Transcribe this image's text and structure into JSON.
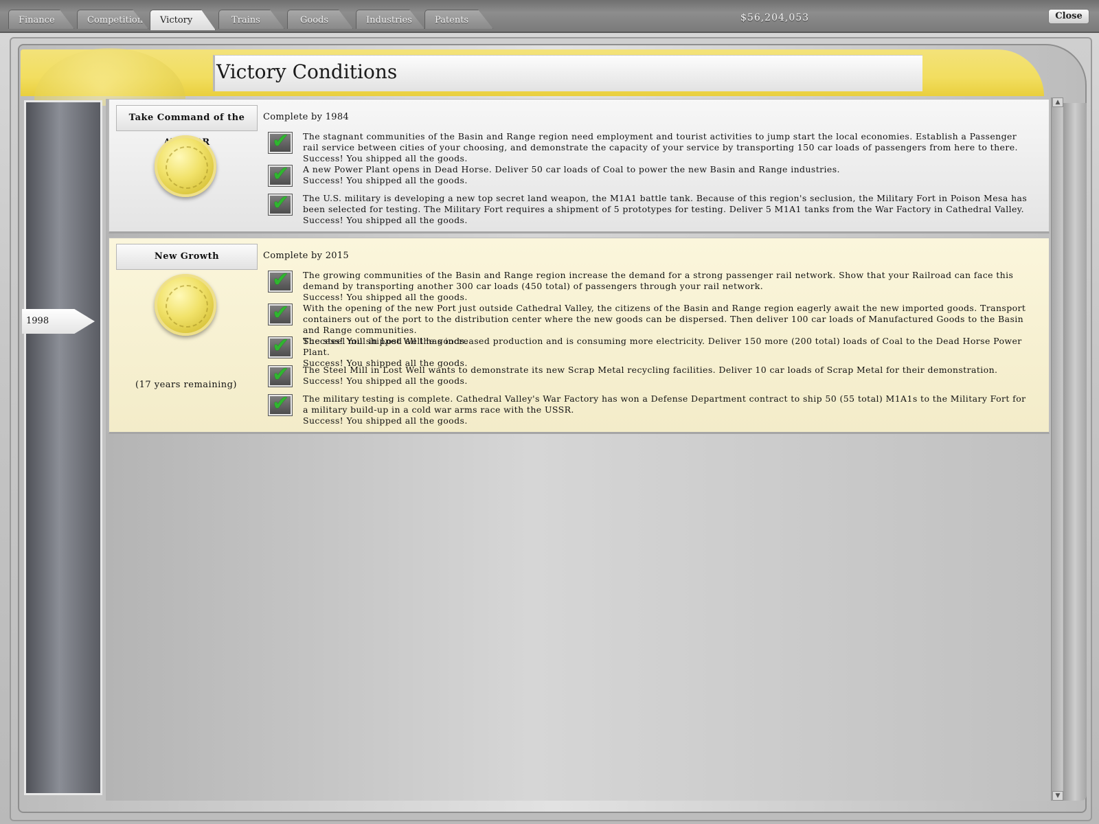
{
  "tabs": [
    "Finance",
    "Competition",
    "Victory",
    "Trains",
    "Goods",
    "Industries",
    "Patents"
  ],
  "active_tab": "Victory",
  "money": "$56,204,053",
  "close_label": "Close",
  "page_title": "Victory Conditions",
  "timeline": {
    "current_year": "1998"
  },
  "conditions": [
    {
      "name": "Take Command of the ATSF RR",
      "deadline": "Complete by 1984",
      "goals": [
        {
          "text": "The stagnant communities of the Basin and Range region need employment and tourist activities to jump start the local economies.  Establish a Passenger rail service between cities of your choosing, and demonstrate the capacity of your service by transporting 150 car loads of passengers from here to there.",
          "status": "Success! You shipped all the goods."
        },
        {
          "text": "A new Power Plant opens in Dead Horse.  Deliver 50 car loads of Coal to power the new Basin and Range industries.",
          "status": "Success! You shipped all the goods."
        },
        {
          "text": "The U.S. military is developing a new top secret land weapon, the M1A1 battle tank.  Because of this region's seclusion, the Military Fort in Poison Mesa has been selected for testing.  The Military Fort requires a shipment of 5 prototypes for testing.  Deliver 5 M1A1 tanks from the War Factory in Cathedral Valley.",
          "status": "Success! You shipped all the goods."
        }
      ]
    },
    {
      "name": "New Growth",
      "deadline": "Complete by 2015",
      "remaining": "(17 years remaining)",
      "goals": [
        {
          "text": "The growing communities of the Basin and Range region increase the demand for a strong passenger rail network.  Show that your Railroad can face this demand by transporting another 300 car loads (450 total) of passengers through your rail network.",
          "status": "Success! You shipped all the goods."
        },
        {
          "text": "With the opening of the new Port just outside Cathedral Valley, the citizens of the Basin and Range region eagerly await the new imported goods.  Transport containers out of the port to the distribution center where the new goods can be dispersed.  Then deliver 100 car loads of Manufactured Goods to the Basin and Range communities.",
          "status": "Success! You shipped all the goods."
        },
        {
          "text": "The steel mill in Lost Well has increased production and is consuming more electricity.  Deliver 150 more (200 total) loads of Coal to the Dead Horse Power Plant.",
          "status": "Success! You shipped all the goods."
        },
        {
          "text": "The Steel Mill in Lost Well wants to demonstrate its new Scrap Metal recycling facilities.  Deliver 10 car loads of Scrap Metal for their demonstration.",
          "status": "Success! You shipped all the goods."
        },
        {
          "text": "The military testing is complete.  Cathedral Valley's War Factory has won a Defense Department contract to ship 50 (55 total) M1A1s to the Military Fort for a military build-up in a cold war arms race with the USSR.",
          "status": "Success! You shipped all the goods."
        }
      ]
    }
  ],
  "icons": {
    "check": "checkmark-icon",
    "medal": "gold-medal-icon",
    "scroll_up": "arrow-up-icon",
    "scroll_down": "arrow-down-icon"
  },
  "colors": {
    "header_gold": "#f2de60",
    "check_green": "#2fb52f",
    "cond2_bg": "#fbf6dc"
  }
}
